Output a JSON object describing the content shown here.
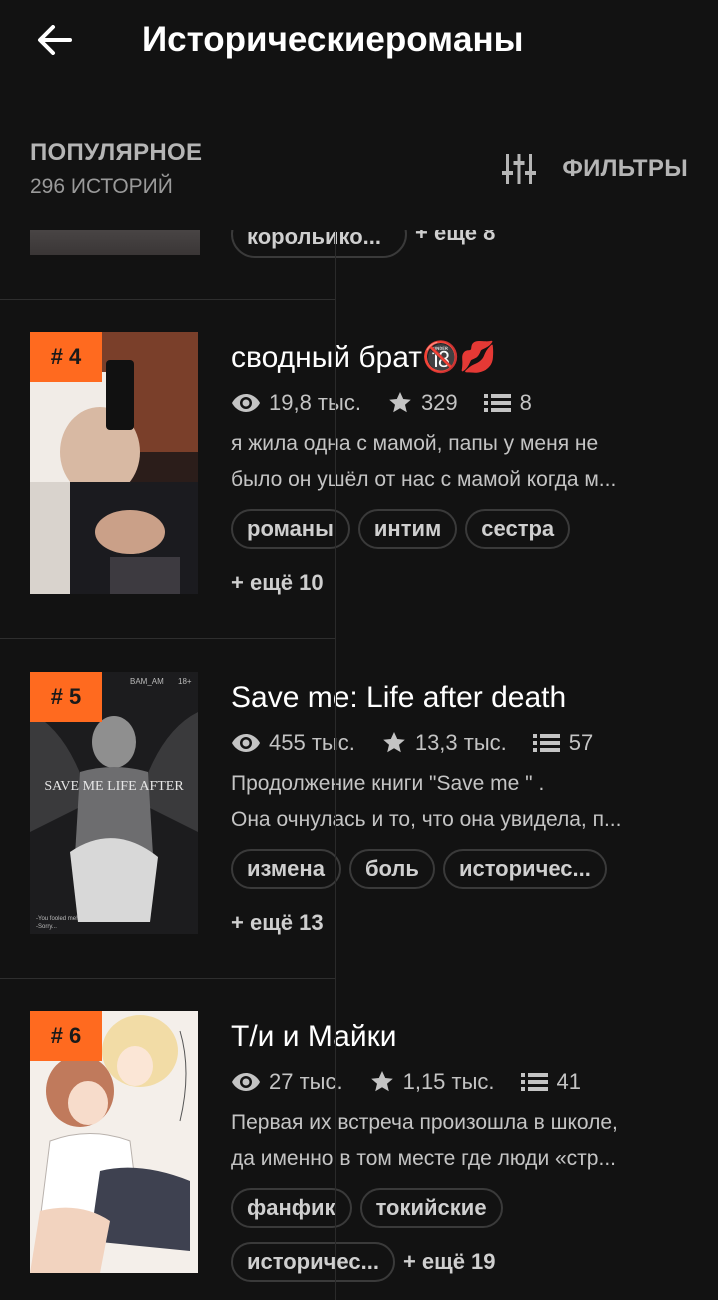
{
  "appbar": {
    "title": "Историческиеромaны"
  },
  "header": {
    "sort_title": "ПОПУЛЯРНОЕ",
    "count": "296 ИСТОРИЙ",
    "filters_label": "ФИЛЬТРЫ"
  },
  "partial": {
    "tag": "корольико...",
    "more": "+ ещё 8"
  },
  "stories": [
    {
      "rank": "# 4",
      "title": "сводный брат🔞💋",
      "views": "19,8 тыс.",
      "votes": "329",
      "parts": "8",
      "desc_line1": "я жила одна с мамой, папы у меня не",
      "desc_line2": "было он ушёл от нас с мамой когда м...",
      "tags": [
        "романы",
        "интим",
        "сестра"
      ],
      "more": "+ ещё 10"
    },
    {
      "rank": "# 5",
      "title": "Save me: Life after death",
      "views": "455 тыс.",
      "votes": "13,3 тыс.",
      "parts": "57",
      "desc_line1": "Продолжение книги  \"Save me \" .",
      "desc_line2": "Она очнулась и то,  что она увидела,  п...",
      "tags": [
        "измена",
        "боль",
        "историчес..."
      ],
      "more": "+ ещё 13"
    },
    {
      "rank": "# 6",
      "title": "Т/и и Майки",
      "views": "27 тыс.",
      "votes": "1,15 тыс.",
      "parts": "41",
      "desc_line1": "Первая их встреча произошла в школе,",
      "desc_line2": "да именно в том месте где люди «стр...",
      "tags": [
        "фанфик",
        "токийские"
      ],
      "tags_row2": [
        "историчес..."
      ],
      "more": "+ ещё 19"
    }
  ],
  "covers": {
    "c5_caption": "SAVE ME LIFE AFTER",
    "c5_author": "BAM_AM",
    "c5_rating": "18+",
    "c5_footer1": "-You fooled me!",
    "c5_footer2": "-Sorry..."
  },
  "colors": {
    "background": "#121212",
    "rank_badge": "#ff6a1f",
    "text_secondary": "#c4c4c4",
    "tag_border": "#3a3a3a"
  }
}
